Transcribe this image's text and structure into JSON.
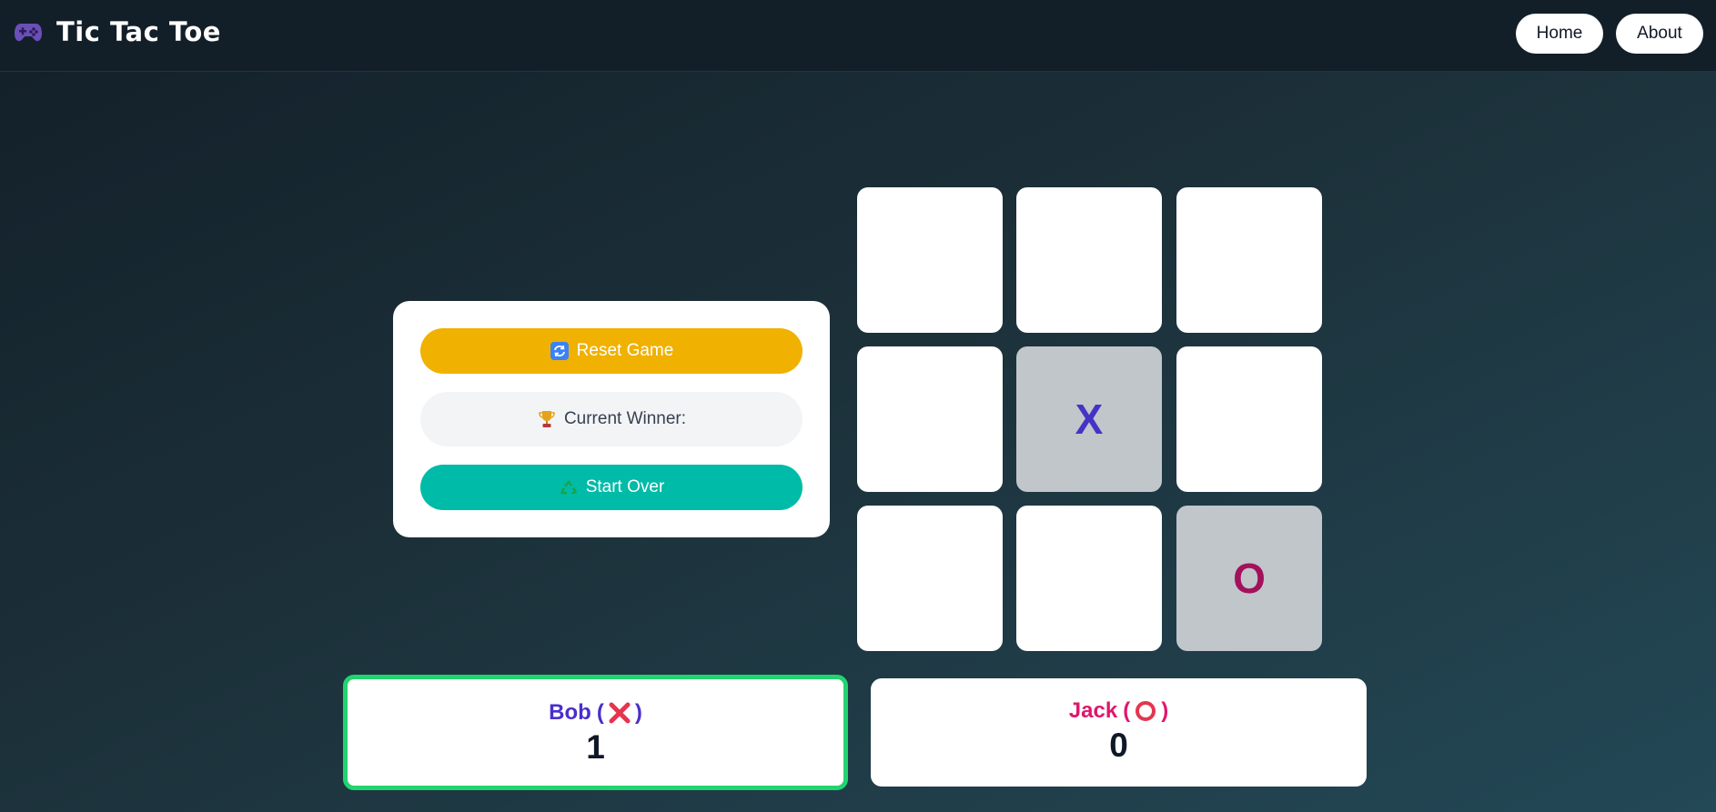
{
  "header": {
    "title": "Tic Tac Toe",
    "logo_icon": "gamepad-icon",
    "nav": [
      {
        "label": "Home"
      },
      {
        "label": "About"
      }
    ]
  },
  "controls": {
    "reset_label": "Reset Game",
    "reset_icon": "refresh-icon",
    "winner_label": "Current Winner:",
    "winner_icon": "trophy-icon",
    "start_over_label": "Start Over",
    "start_over_icon": "recycle-icon"
  },
  "board": {
    "cells": [
      "",
      "",
      "",
      "",
      "X",
      "",
      "",
      "",
      "O"
    ]
  },
  "players": [
    {
      "name": "Bob",
      "symbol_icon": "cross-mark-icon",
      "score": "1",
      "active": true,
      "color": "#4a2fcb"
    },
    {
      "name": "Jack",
      "symbol_icon": "circle-mark-icon",
      "score": "0",
      "active": false,
      "color": "#e0166e"
    }
  ],
  "colors": {
    "reset_button": "#f0b100",
    "start_over_button": "#00bba7",
    "active_border": "#22d46e",
    "x_mark": "#4533c6",
    "o_mark": "#a3115d"
  }
}
